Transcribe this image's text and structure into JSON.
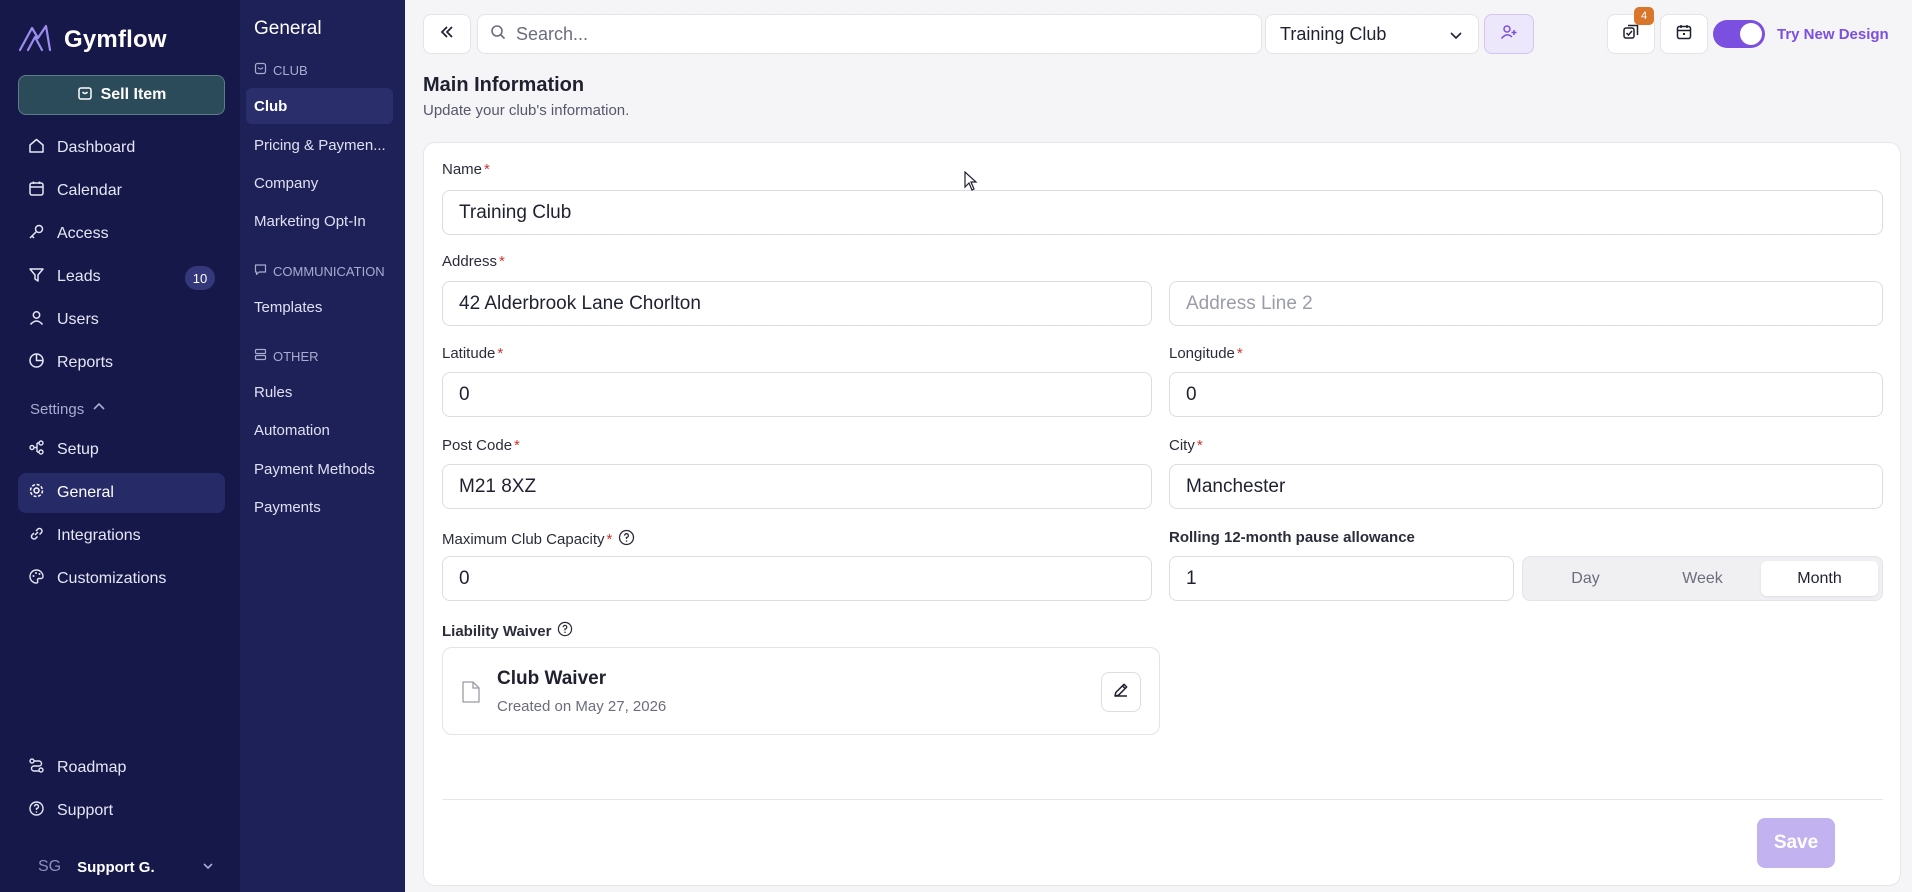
{
  "brand": {
    "name": "Gymflow",
    "sell_label": "Sell Item"
  },
  "nav": {
    "items": [
      {
        "label": "Dashboard"
      },
      {
        "label": "Calendar"
      },
      {
        "label": "Access"
      },
      {
        "label": "Leads",
        "badge": "10"
      },
      {
        "label": "Users"
      },
      {
        "label": "Reports"
      }
    ],
    "settings_label": "Settings",
    "settings_items": [
      {
        "label": "Setup"
      },
      {
        "label": "General"
      },
      {
        "label": "Integrations"
      },
      {
        "label": "Customizations"
      }
    ],
    "bottom_items": [
      {
        "label": "Roadmap"
      },
      {
        "label": "Support"
      }
    ],
    "user": {
      "initials": "SG",
      "name": "Support G."
    }
  },
  "subnav": {
    "title": "General",
    "sections": [
      {
        "title": "CLUB",
        "items": [
          "Club",
          "Pricing & Paymen...",
          "Company",
          "Marketing Opt-In"
        ]
      },
      {
        "title": "COMMUNICATION",
        "items": [
          "Templates"
        ]
      },
      {
        "title": "OTHER",
        "items": [
          "Rules",
          "Automation",
          "Payment Methods",
          "Payments"
        ]
      }
    ]
  },
  "topbar": {
    "search_placeholder": "Search...",
    "club_selected": "Training Club",
    "notifications_count": "4",
    "try_new_design": "Try New Design",
    "accent": "#7b4fe0"
  },
  "page": {
    "title": "Main Information",
    "subtitle": "Update your club's information."
  },
  "form": {
    "name_label": "Name",
    "name_value": "Training Club",
    "address_label": "Address",
    "address_value": "42 Alderbrook Lane Chorlton",
    "address2_placeholder": "Address Line 2",
    "latitude_label": "Latitude",
    "latitude_value": "0",
    "longitude_label": "Longitude",
    "longitude_value": "0",
    "postcode_label": "Post Code",
    "postcode_value": "M21 8XZ",
    "city_label": "City",
    "city_value": "Manchester",
    "capacity_label": "Maximum Club Capacity",
    "capacity_value": "0",
    "pause_label": "Rolling 12-month pause allowance",
    "pause_value": "1",
    "pause_units": [
      "Day",
      "Week",
      "Month"
    ],
    "pause_unit_selected": "Month",
    "waiver_label": "Liability Waiver",
    "waiver_title": "Club Waiver",
    "waiver_date": "Created on May 27, 2026",
    "required_mark": "*",
    "save_label": "Save"
  }
}
